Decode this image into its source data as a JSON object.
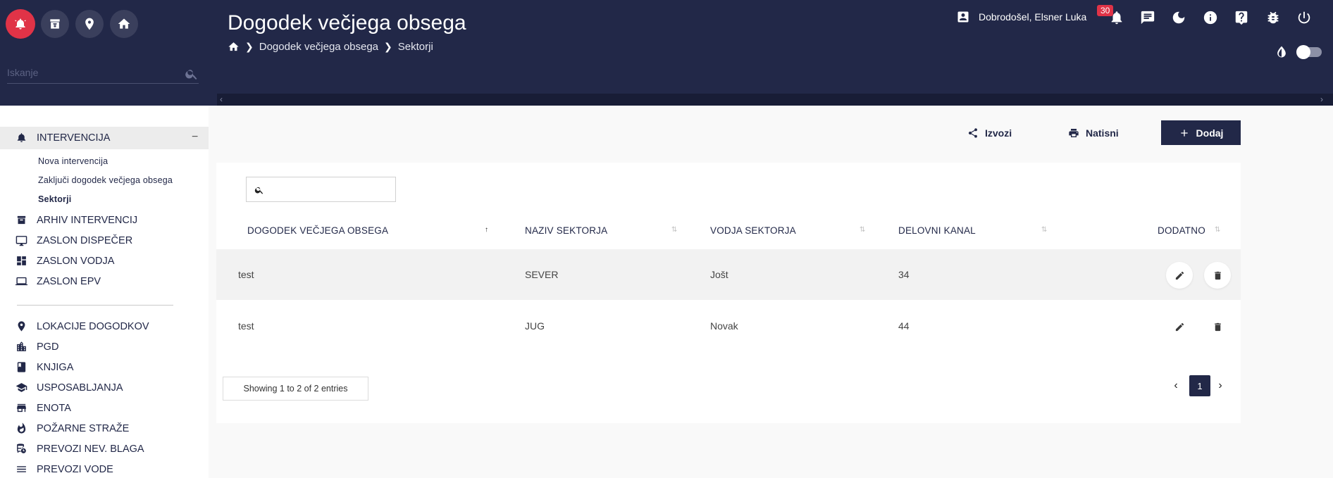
{
  "header": {
    "title": "Dogodek večjega obsega",
    "breadcrumb": [
      "Dogodek večjega obsega",
      "Sektorji"
    ],
    "user_greeting": "Dobrodošel, Elsner Luka",
    "notification_count": "30",
    "theme_toggle_on": false
  },
  "search": {
    "placeholder": "Iskanje"
  },
  "sidebar": {
    "group": {
      "label": "INTERVENCIJA",
      "icon": "alarm-bell-icon",
      "collapse_symbol": "−",
      "items": [
        "Nova intervencija",
        "Zaključi dogodek večjega obsega",
        "Sektorji"
      ],
      "active_item": "Sektorji"
    },
    "items": [
      {
        "label": "ARHIV INTERVENCIJ",
        "icon": "archive-icon"
      },
      {
        "label": "ZASLON DISPEČER",
        "icon": "monitor-icon"
      },
      {
        "label": "ZASLON VODJA",
        "icon": "dashboard-icon"
      },
      {
        "label": "ZASLON EPV",
        "icon": "laptop-icon"
      }
    ],
    "items2": [
      {
        "label": "LOKACIJE DOGODKOV",
        "icon": "location-pin-icon"
      },
      {
        "label": "PGD",
        "icon": "building-icon"
      },
      {
        "label": "KNJIGA",
        "icon": "book-icon"
      },
      {
        "label": "USPOSABLJANJA",
        "icon": "graduation-cap-icon"
      },
      {
        "label": "ENOTA",
        "icon": "store-icon"
      },
      {
        "label": "POŽARNE STRAŽE",
        "icon": "fire-icon"
      },
      {
        "label": "PREVOZI NEV. BLAGA",
        "icon": "bus-clock-icon"
      },
      {
        "label": "PREVOZI VODE",
        "icon": "water-icon"
      }
    ]
  },
  "toolbar": {
    "export_label": "Izvozi",
    "print_label": "Natisni",
    "add_label": "Dodaj"
  },
  "table": {
    "search_value": "",
    "columns": [
      "DOGODEK VEČJEGA OBSEGA",
      "NAZIV SEKTORJA",
      "VODJA SEKTORJA",
      "DELOVNI KANAL",
      "DODATNO"
    ],
    "rows": [
      [
        "test",
        "SEVER",
        "Jošt",
        "34"
      ],
      [
        "test",
        "JUG",
        "Novak",
        "44"
      ]
    ],
    "info": "Showing 1 to 2 of 2 entries",
    "page": "1"
  },
  "colors": {
    "navy": "#222848",
    "accent_red": "#e03347"
  }
}
